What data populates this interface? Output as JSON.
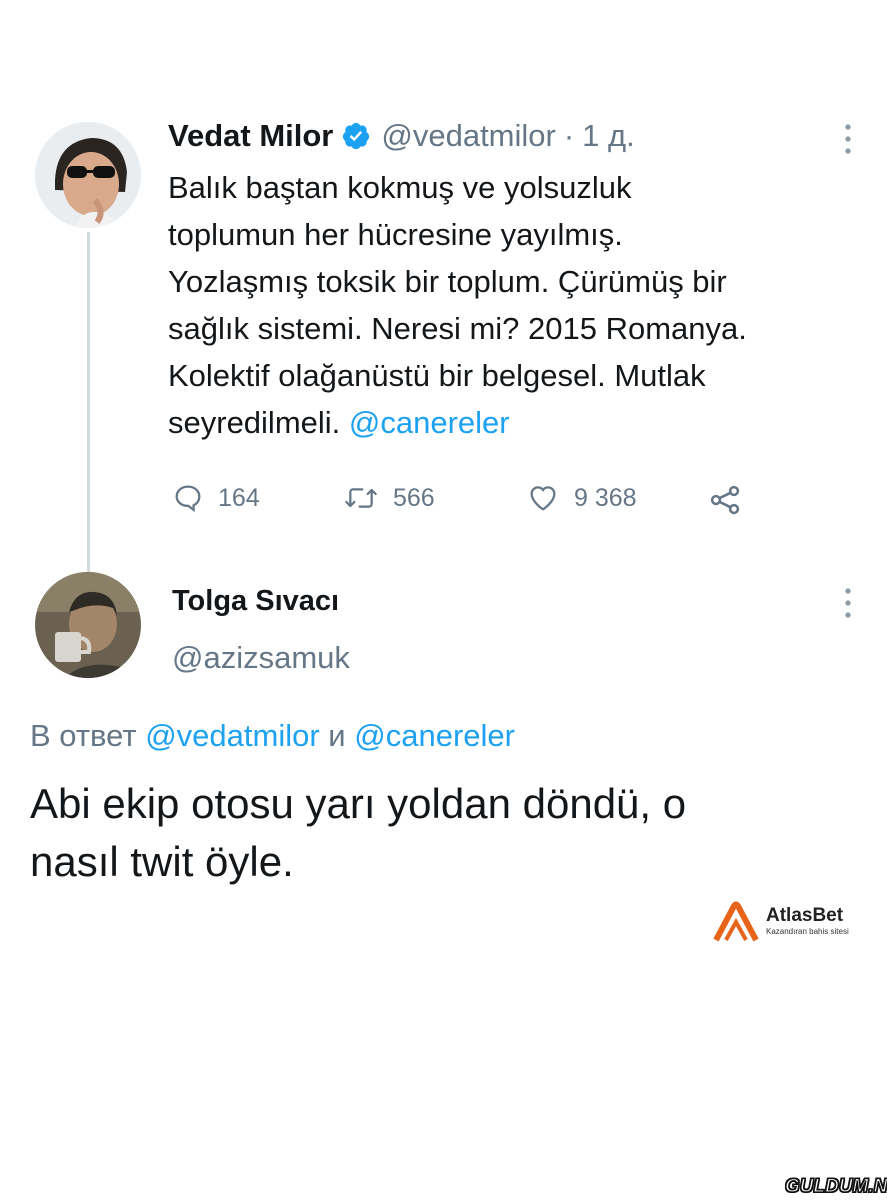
{
  "tweet": {
    "author_name": "Vedat Milor",
    "handle": "@vedatmilor",
    "separator": "·",
    "time": "1 д.",
    "text_lines": [
      "Balık baştan kokmuş ve yolsuzluk",
      "toplumun her hücresine yayılmış.",
      "Yozlaşmış toksik bir toplum. Çürümüş bir",
      "sağlık sistemi. Neresi mi? 2015 Romanya.",
      "Kolektif olağanüstü bir belgesel. Mutlak"
    ],
    "last_line_text": "seyredilmeli. ",
    "mention": "@canereler",
    "replies": "164",
    "retweets": "566",
    "likes": "9 368"
  },
  "reply": {
    "author_name": "Tolga Sıvacı",
    "handle": "@azizsamuk",
    "reply_to_prefix": "В ответ",
    "reply_to_user1": "@vedatmilor",
    "reply_to_and": "и",
    "reply_to_user2": "@canereler",
    "text_lines": [
      "Abi ekip otosu yarı yoldan döndü, o",
      "nasıl twit öyle."
    ]
  },
  "watermark": {
    "brand": "AtlasBet",
    "tagline": "Kazandıran bahis sitesi",
    "site": "GULDUM.NET"
  },
  "colors": {
    "accent": "#1da1f2",
    "text": "#14171a",
    "muted": "#657786",
    "brand_orange": "#e8641b"
  }
}
